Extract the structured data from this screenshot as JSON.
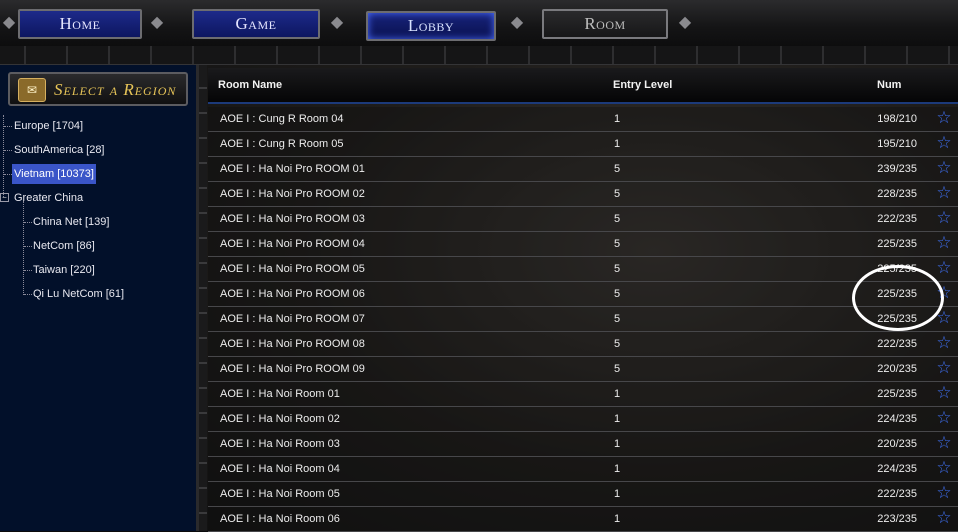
{
  "nav": {
    "tabs": [
      {
        "label": "Home"
      },
      {
        "label": "Game"
      },
      {
        "label": "Lobby"
      },
      {
        "label": "Room"
      }
    ],
    "active": "Lobby"
  },
  "sidebar": {
    "title": "Select a Region",
    "regions": [
      {
        "label": "Europe [1704]"
      },
      {
        "label": "SouthAmerica [28]"
      },
      {
        "label": "Vietnam [10373]",
        "selected": true
      },
      {
        "label": "Greater China",
        "expanded": true,
        "children": [
          {
            "label": "China Net [139]"
          },
          {
            "label": "NetCom [86]"
          },
          {
            "label": "Taiwan [220]"
          },
          {
            "label": "Qi Lu NetCom [61]"
          }
        ]
      }
    ]
  },
  "table": {
    "columns": [
      "Room Name",
      "Entry Level",
      "Num"
    ],
    "rows": [
      {
        "name": "AOE I : Cung R Room 04",
        "level": "1",
        "num": "198/210"
      },
      {
        "name": "AOE I : Cung R Room 05",
        "level": "1",
        "num": "195/210"
      },
      {
        "name": "AOE I : Ha Noi Pro ROOM 01",
        "level": "5",
        "num": "239/235"
      },
      {
        "name": "AOE I : Ha Noi Pro ROOM 02",
        "level": "5",
        "num": "228/235"
      },
      {
        "name": "AOE I : Ha Noi Pro ROOM 03",
        "level": "5",
        "num": "222/235"
      },
      {
        "name": "AOE I : Ha Noi Pro ROOM 04",
        "level": "5",
        "num": "225/235"
      },
      {
        "name": "AOE I : Ha Noi Pro ROOM 05",
        "level": "5",
        "num": "225/235"
      },
      {
        "name": "AOE I : Ha Noi Pro ROOM 06",
        "level": "5",
        "num": "225/235"
      },
      {
        "name": "AOE I : Ha Noi Pro ROOM 07",
        "level": "5",
        "num": "225/235"
      },
      {
        "name": "AOE I : Ha Noi Pro ROOM 08",
        "level": "5",
        "num": "222/235"
      },
      {
        "name": "AOE I : Ha Noi Pro ROOM 09",
        "level": "5",
        "num": "220/235"
      },
      {
        "name": "AOE I : Ha Noi Room 01",
        "level": "1",
        "num": "225/235"
      },
      {
        "name": "AOE I : Ha Noi Room 02",
        "level": "1",
        "num": "224/235"
      },
      {
        "name": "AOE I : Ha Noi Room 03",
        "level": "1",
        "num": "220/235"
      },
      {
        "name": "AOE I : Ha Noi Room 04",
        "level": "1",
        "num": "224/235"
      },
      {
        "name": "AOE I : Ha Noi Room 05",
        "level": "1",
        "num": "222/235"
      },
      {
        "name": "AOE I : Ha Noi Room 06",
        "level": "1",
        "num": "223/235"
      }
    ],
    "favorite_icon": "star-outline-icon",
    "accent_color": "#3f6ff0"
  },
  "annotation": {
    "shape": "hand-drawn white circle around rows 06-07 player counts"
  }
}
